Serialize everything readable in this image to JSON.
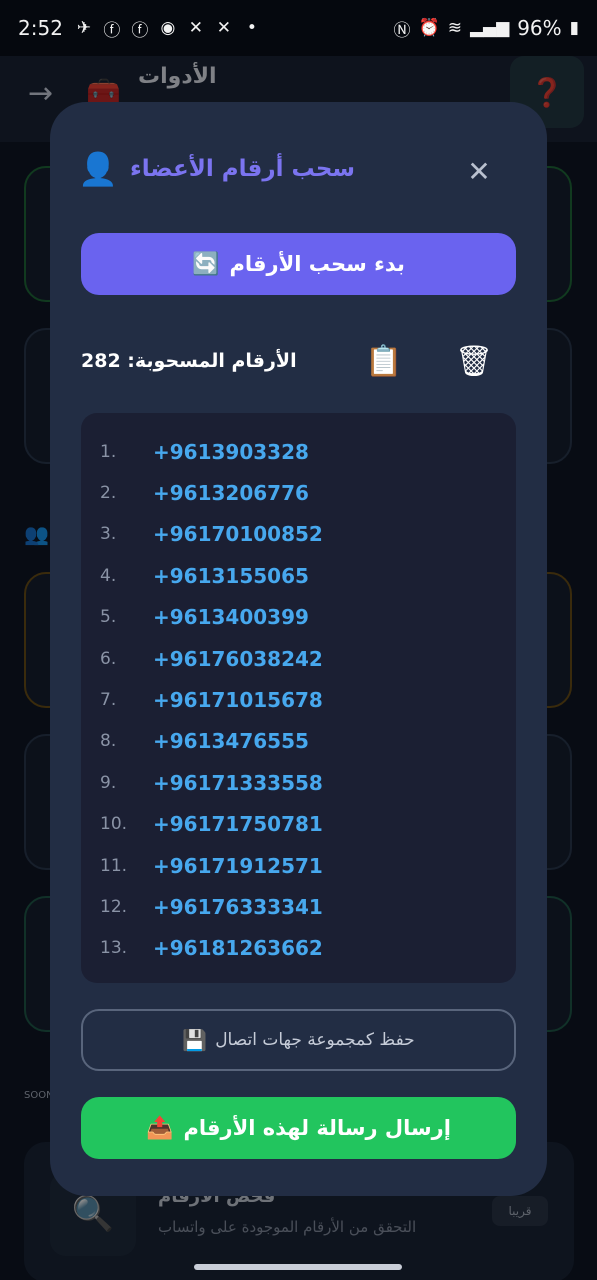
{
  "status_bar": {
    "time": "2:52",
    "notification_icons": [
      "telegram-icon",
      "facebook-icon",
      "facebook-icon",
      "app-icon",
      "x-icon",
      "x-icon",
      "dot-icon"
    ],
    "battery": "96%"
  },
  "background": {
    "header_title": "الأدوات",
    "bottom_card_title": "فحص الأرقام",
    "bottom_card_subtitle": "التحقق من الأرقام الموجودة على واتساب",
    "soon_badge": "قريبا",
    "soon_label": "SOON"
  },
  "modal": {
    "title": "سحب أرقام الأعضاء",
    "start_button": "بدء سحب الأرقام",
    "count_label": "الأرقام المسحوبة:",
    "count_value": "282",
    "numbers": [
      {
        "index": "1.",
        "phone": "+9613903328"
      },
      {
        "index": "2.",
        "phone": "+9613206776"
      },
      {
        "index": "3.",
        "phone": "+96170100852"
      },
      {
        "index": "4.",
        "phone": "+9613155065"
      },
      {
        "index": "5.",
        "phone": "+9613400399"
      },
      {
        "index": "6.",
        "phone": "+96176038242"
      },
      {
        "index": "7.",
        "phone": "+96171015678"
      },
      {
        "index": "8.",
        "phone": "+9613476555"
      },
      {
        "index": "9.",
        "phone": "+96171333558"
      },
      {
        "index": "10.",
        "phone": "+96171750781"
      },
      {
        "index": "11.",
        "phone": "+96171912571"
      },
      {
        "index": "12.",
        "phone": "+96176333341"
      },
      {
        "index": "13.",
        "phone": "+96181263662"
      }
    ],
    "save_button": "حفظ كمجموعة جهات اتصال",
    "send_button": "إرسال رسالة لهذه الأرقام"
  },
  "colors": {
    "accent": "#6a63ef",
    "success": "#22c55e",
    "phone_text": "#47a8ee",
    "modal_bg": "#222d44"
  }
}
